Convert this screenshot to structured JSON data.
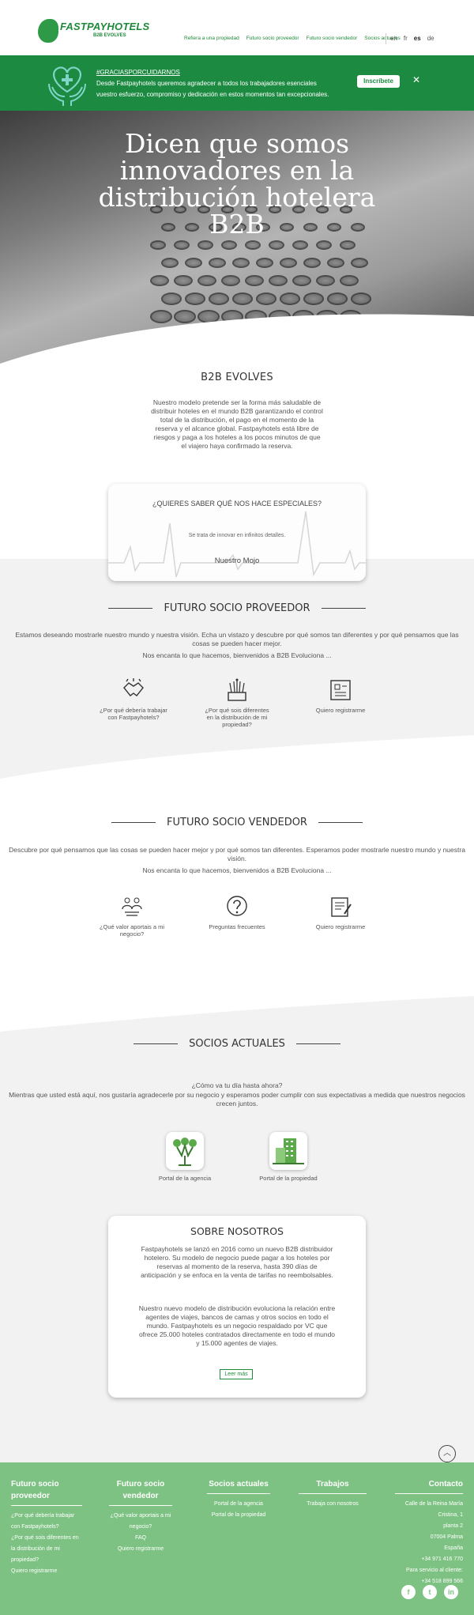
{
  "header": {
    "brand": "FASTPAYHOTELS",
    "tagline": "B2B EVOLVES",
    "nav": [
      "Refiera a una propiedad",
      "Futuro socio proveedor",
      "Futuro socio vendedor",
      "Socios actuales"
    ],
    "languages": [
      "en",
      "fr",
      "es",
      "de"
    ],
    "active_language": "es"
  },
  "banner": {
    "hashtag": "#GRACIASPORCUIDARNOS",
    "text": "Desde Fastpayhotels queremos agradecer a todos los trabajadores esenciales vuestro esfuerzo, compromiso y dedicación en estos momentos tan excepcionales.",
    "button": "Inscríbete",
    "close": "✕"
  },
  "hero": {
    "title": "Dicen que somos innovadores en la distribución hotelera B2B"
  },
  "b2b": {
    "title": "B2B EVOLVES",
    "text": "Nuestro modelo pretende ser la forma más saludable de distribuir hoteles en el mundo B2B garantizando el control total de la distribución, el pago en el momento de la reserva y el alcance global. Fastpayhotels está libre de riesgos y paga a los hoteles a los pocos minutos de que el viajero haya confirmado la reserva."
  },
  "mojo": {
    "question": "¿QUIERES SABER QUÉ NOS HACE ESPECIALES?",
    "subtitle": "Se trata de innovar en infinitos detalles.",
    "name": "Nuestro Mojo"
  },
  "proveedor": {
    "title": "FUTURO SOCIO PROVEEDOR",
    "para1": "Estamos deseando mostrarle nuestro mundo y nuestra visión. Echa un vistazo y descubre por qué somos tan diferentes y por qué pensamos que las cosas se pueden hacer mejor.",
    "para2": "Nos encanta lo que hacemos, bienvenidos a B2B Evoluciona ...",
    "cards": [
      {
        "label": "¿Por qué debería trabajar con Fastpayhotels?",
        "icon": "handshake-icon"
      },
      {
        "label": "¿Por qué sois diferentes en la distribución de mi propiedad?",
        "icon": "network-icon"
      },
      {
        "label": "Quiero registrarme",
        "icon": "register-icon"
      }
    ]
  },
  "vendedor": {
    "title": "FUTURO SOCIO VENDEDOR",
    "para1": "Descubre por qué pensamos que las cosas se pueden hacer mejor y por qué somos tan diferentes. Esperamos poder mostrarle nuestro mundo y nuestra visión.",
    "para2": "Nos encanta lo que hacemos, bienvenidos a B2B Evoluciona ...",
    "cards": [
      {
        "label": "¿Qué valor aportais a mi negocio?",
        "icon": "people-icon"
      },
      {
        "label": "Preguntas frecuentes",
        "icon": "question-icon"
      },
      {
        "label": "Quiero registrarme",
        "icon": "clipboard-icon"
      }
    ]
  },
  "socios": {
    "title": "SOCIOS ACTUALES",
    "para1": "¿Cómo va tu día hasta ahora?",
    "para2": "Mientras que usted está aquí, nos gustaría agradecerle por su negocio y esperamos poder cumplir con sus expectativas a medida que nuestros negocios crecen juntos.",
    "portals": [
      {
        "label": "Portal de la agencia",
        "icon": "agency-icon"
      },
      {
        "label": "Portal de la propiedad",
        "icon": "building-icon"
      }
    ]
  },
  "about": {
    "title": "SOBRE NOSOTROS",
    "p1": "Fastpayhotels se lanzó en 2016 como un nuevo B2B distribuidor hotelero. Su modelo de negocio puede pagar a los hoteles por reservas al momento de la reserva, hasta 390 días de anticipación y se enfoca en la venta de tarifas no reembolsables.",
    "p2": "Nuestro nuevo modelo de distribución evoluciona la relación entre agentes de viajes, bancos de camas y otros socios en todo el mundo. Fastpayhotels es un negocio respaldado por VC que ofrece 25.000 hoteles contratados directamente en todo el mundo y 15.000 agentes de viajes.",
    "button": "Leer más"
  },
  "footer": {
    "col1": {
      "title": "Futuro socio proveedor",
      "items": [
        "¿Por qué debería trabajar con Fastpayhotels?",
        "¿Por qué sois diferentes en la distribución de mi propiedad?",
        "Quiero registrarme"
      ]
    },
    "col2": {
      "title": "Futuro socio vendedor",
      "items": [
        "¿Qué valor aportais a mi negocio?",
        "FAQ",
        "Quiero registrarme"
      ]
    },
    "col3": {
      "title": "Socios actuales",
      "items": [
        "Portal de la agencia",
        "Portal de la propiedad"
      ]
    },
    "col4": {
      "title": "Trabajos",
      "items": [
        "Trabaja con nosotros"
      ]
    },
    "col5": {
      "title": "Contacto",
      "items": [
        "Calle de la Reina María Cristina, 1",
        "planta 2",
        "07004 Palma",
        "España",
        "+34 971 416 770",
        "Para servicio al cliente:",
        "+34 518 899 566"
      ]
    },
    "social": [
      "f",
      "t",
      "in"
    ]
  },
  "colors": {
    "brand_green": "#1d8a42",
    "footer_green": "#7dc283"
  }
}
